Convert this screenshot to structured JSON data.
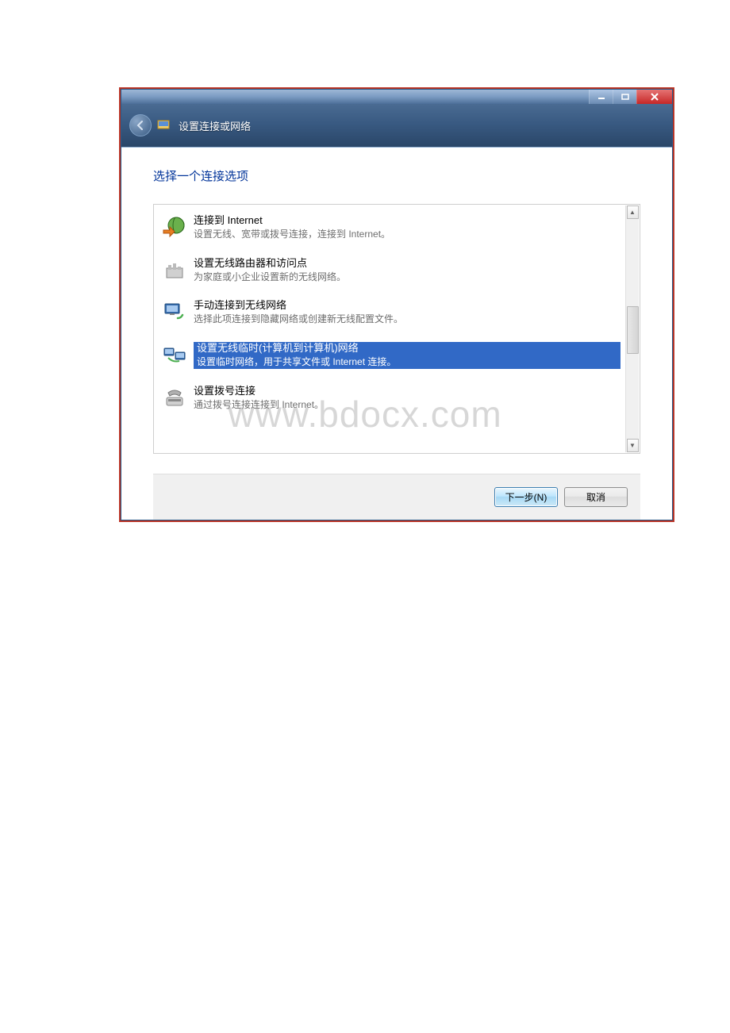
{
  "window": {
    "title": "设置连接或网络"
  },
  "page": {
    "heading": "选择一个连接选项"
  },
  "options": [
    {
      "title": "连接到 Internet",
      "desc": "设置无线、宽带或拨号连接，连接到 Internet。",
      "selected": false
    },
    {
      "title": "设置无线路由器和访问点",
      "desc": "为家庭或小企业设置新的无线网络。",
      "selected": false
    },
    {
      "title": "手动连接到无线网络",
      "desc": "选择此项连接到隐藏网络或创建新无线配置文件。",
      "selected": false
    },
    {
      "title": "设置无线临时(计算机到计算机)网络",
      "desc": "设置临时网络，用于共享文件或 Internet 连接。",
      "selected": true
    },
    {
      "title": "设置拨号连接",
      "desc": "通过拨号连接连接到 Internet。",
      "selected": false
    }
  ],
  "buttons": {
    "next": "下一步(N)",
    "cancel": "取消"
  },
  "watermark": "www.bdocx.com"
}
